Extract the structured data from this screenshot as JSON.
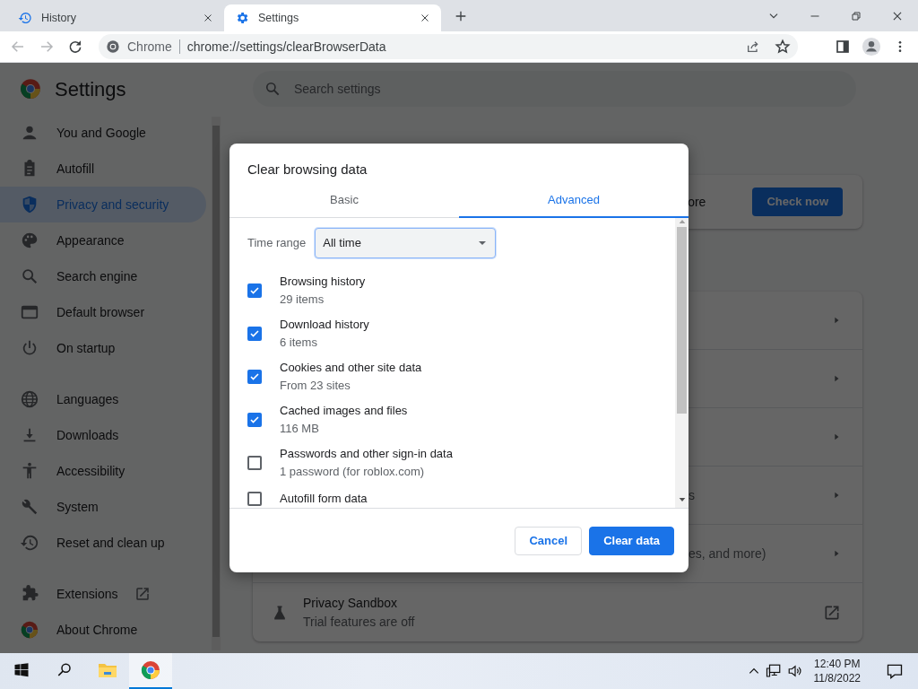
{
  "browser": {
    "tabs": [
      {
        "title": "History",
        "kind": "history",
        "selected": false
      },
      {
        "title": "Settings",
        "kind": "gear",
        "selected": true
      }
    ],
    "omnibox": {
      "site": "Chrome",
      "url": "chrome://settings/clearBrowserData"
    }
  },
  "settings": {
    "title": "Settings",
    "search": {
      "placeholder": "Search settings"
    },
    "sidebar": {
      "sections": [
        [
          {
            "label": "You and Google",
            "kind": "person",
            "selected": false
          },
          {
            "label": "Autofill",
            "kind": "clipboard",
            "selected": false
          },
          {
            "label": "Privacy and security",
            "kind": "shield",
            "selected": true
          },
          {
            "label": "Appearance",
            "kind": "palette",
            "selected": false
          },
          {
            "label": "Search engine",
            "kind": "search",
            "selected": false
          },
          {
            "label": "Default browser",
            "kind": "browser",
            "selected": false
          },
          {
            "label": "On startup",
            "kind": "power",
            "selected": false
          }
        ],
        [
          {
            "label": "Languages",
            "kind": "globe",
            "selected": false
          },
          {
            "label": "Downloads",
            "kind": "download",
            "selected": false
          },
          {
            "label": "Accessibility",
            "kind": "accessibility",
            "selected": false
          },
          {
            "label": "System",
            "kind": "wrench",
            "selected": false
          },
          {
            "label": "Reset and clean up",
            "kind": "history",
            "selected": false
          }
        ],
        [
          {
            "label": "Extensions",
            "kind": "puzzle",
            "selected": false,
            "external": true
          },
          {
            "label": "About Chrome",
            "kind": "chrome",
            "selected": false
          }
        ]
      ]
    },
    "safety_card": {
      "text": "ore",
      "button": "Check now"
    },
    "rows": [
      {
        "kind": "arrow"
      },
      {
        "kind": "arrow"
      },
      {
        "kind": "arrow"
      },
      {
        "kind": "arrow",
        "text": "s"
      },
      {
        "kind": "arrow",
        "text": "es, and more)"
      },
      {
        "kind": "external",
        "title": "Privacy Sandbox",
        "subtitle": "Trial features are off"
      }
    ]
  },
  "dialog": {
    "title": "Clear browsing data",
    "tabs": [
      {
        "label": "Basic",
        "selected": false
      },
      {
        "label": "Advanced",
        "selected": true
      }
    ],
    "time_range": {
      "label": "Time range",
      "value": "All time"
    },
    "items": [
      {
        "title": "Browsing history",
        "subtitle": "29 items",
        "checked": true
      },
      {
        "title": "Download history",
        "subtitle": "6 items",
        "checked": true
      },
      {
        "title": "Cookies and other site data",
        "subtitle": "From 23 sites",
        "checked": true
      },
      {
        "title": "Cached images and files",
        "subtitle": "116 MB",
        "checked": true
      },
      {
        "title": "Passwords and other sign-in data",
        "subtitle": "1 password (for roblox.com)",
        "checked": false
      },
      {
        "title": "Autofill form data",
        "checked": false
      }
    ],
    "buttons": [
      {
        "label": "Cancel",
        "kind": "secondary"
      },
      {
        "label": "Clear data",
        "kind": "primary"
      }
    ]
  },
  "taskbar": {
    "apps": [
      {
        "kind": "start",
        "active": false
      },
      {
        "kind": "search",
        "active": false
      },
      {
        "kind": "folder",
        "active": false
      },
      {
        "kind": "chrome",
        "active": true
      }
    ],
    "time": "12:40 PM",
    "date": "11/8/2022"
  }
}
